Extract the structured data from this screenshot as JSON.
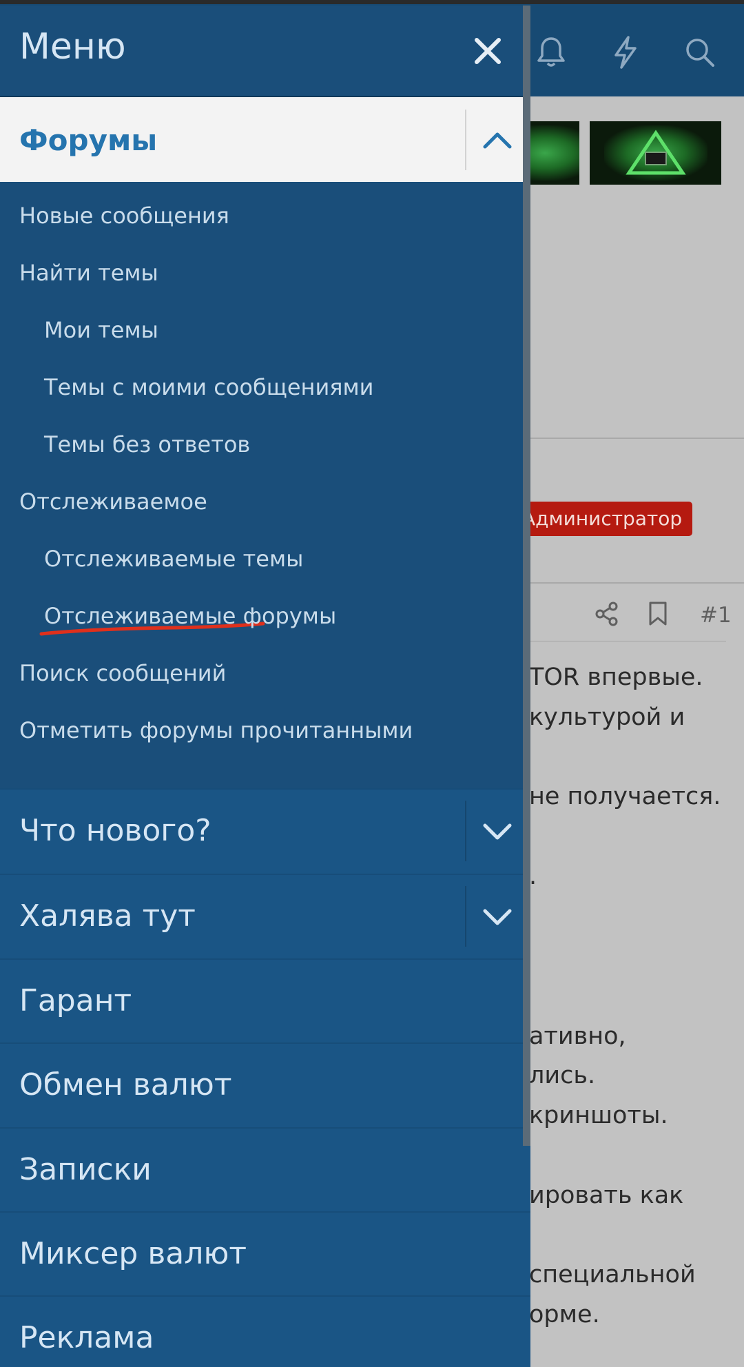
{
  "header": {
    "icons": [
      "bell-icon",
      "lightning-icon",
      "search-icon"
    ]
  },
  "background": {
    "role_badge": "Администратор",
    "post_number": "#1",
    "post_lines": [
      "TOR впервые.",
      "культурой и",
      "не получается.",
      ".",
      "ативно,",
      "лись.",
      "криншоты.",
      "ировать как",
      "специальной",
      "орме."
    ]
  },
  "drawer": {
    "title": "Меню",
    "close_icon": "close-icon",
    "forums": {
      "label": "Форумы",
      "expanded": true,
      "items": [
        {
          "label": "Новые сообщения",
          "level": 0
        },
        {
          "label": "Найти темы",
          "level": 0
        },
        {
          "label": "Мои темы",
          "level": 1
        },
        {
          "label": "Темы с моими сообщениями",
          "level": 1
        },
        {
          "label": "Темы без ответов",
          "level": 1,
          "underlined": true
        },
        {
          "label": "Отслеживаемое",
          "level": 0
        },
        {
          "label": "Отслеживаемые темы",
          "level": 1
        },
        {
          "label": "Отслеживаемые форумы",
          "level": 1
        },
        {
          "label": "Поиск сообщений",
          "level": 0
        },
        {
          "label": "Отметить форумы прочитанными",
          "level": 0
        }
      ]
    },
    "sections": [
      {
        "label": "Что нового?",
        "expandable": true
      },
      {
        "label": "Халява тут",
        "expandable": true
      },
      {
        "label": "Гарант",
        "expandable": false
      },
      {
        "label": "Обмен валют",
        "expandable": false
      },
      {
        "label": "Записки",
        "expandable": false
      },
      {
        "label": "Миксер валют",
        "expandable": false
      },
      {
        "label": "Реклама",
        "expandable": false
      }
    ]
  },
  "colors": {
    "drawer_bg": "#1a5585",
    "submenu_bg": "#1a4e7a",
    "active_accent": "#2574ae",
    "badge_red": "#b51a10",
    "annotation_red": "#e0301c"
  }
}
